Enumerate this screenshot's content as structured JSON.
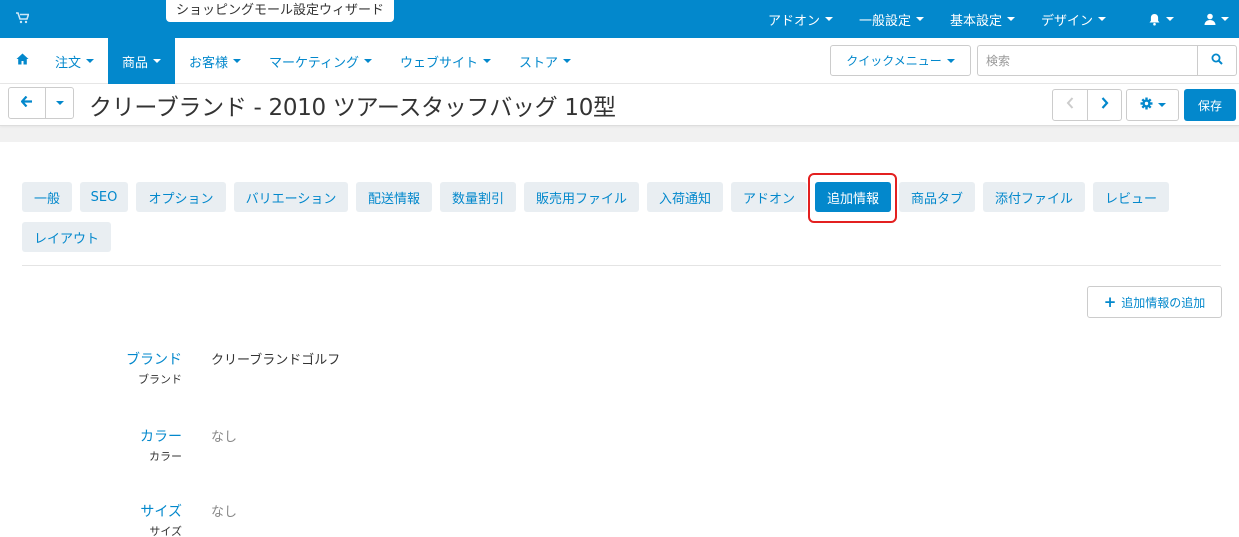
{
  "topbar": {
    "wizard_label": "ショッピングモール設定ウィザード",
    "menu": [
      "アドオン",
      "一般設定",
      "基本設定",
      "デザイン"
    ]
  },
  "nav": {
    "items": [
      "注文",
      "商品",
      "お客様",
      "マーケティング",
      "ウェブサイト",
      "ストア"
    ],
    "active": "商品",
    "quick_menu_label": "クイックメニュー",
    "search_placeholder": "検索"
  },
  "page": {
    "title": "クリーブランド - 2010 ツアースタッフバッグ 10型",
    "save_label": "保存"
  },
  "tabs": [
    "一般",
    "SEO",
    "オプション",
    "バリエーション",
    "配送情報",
    "数量割引",
    "販売用ファイル",
    "入荷通知",
    "アドオン",
    "追加情報",
    "商品タブ",
    "添付ファイル",
    "レビュー",
    "レイアウト"
  ],
  "active_tab": "追加情報",
  "add_feature_label": "追加情報の追加",
  "features": [
    {
      "name": "ブランド",
      "sub": "ブランド",
      "value": "クリーブランドゴルフ"
    },
    {
      "name": "カラー",
      "sub": "カラー",
      "value": "なし"
    },
    {
      "name": "サイズ",
      "sub": "サイズ",
      "value": "なし"
    }
  ],
  "colors": {
    "primary": "#0388cc",
    "tab_bg": "#e9eef2",
    "highlight": "#e32020"
  }
}
